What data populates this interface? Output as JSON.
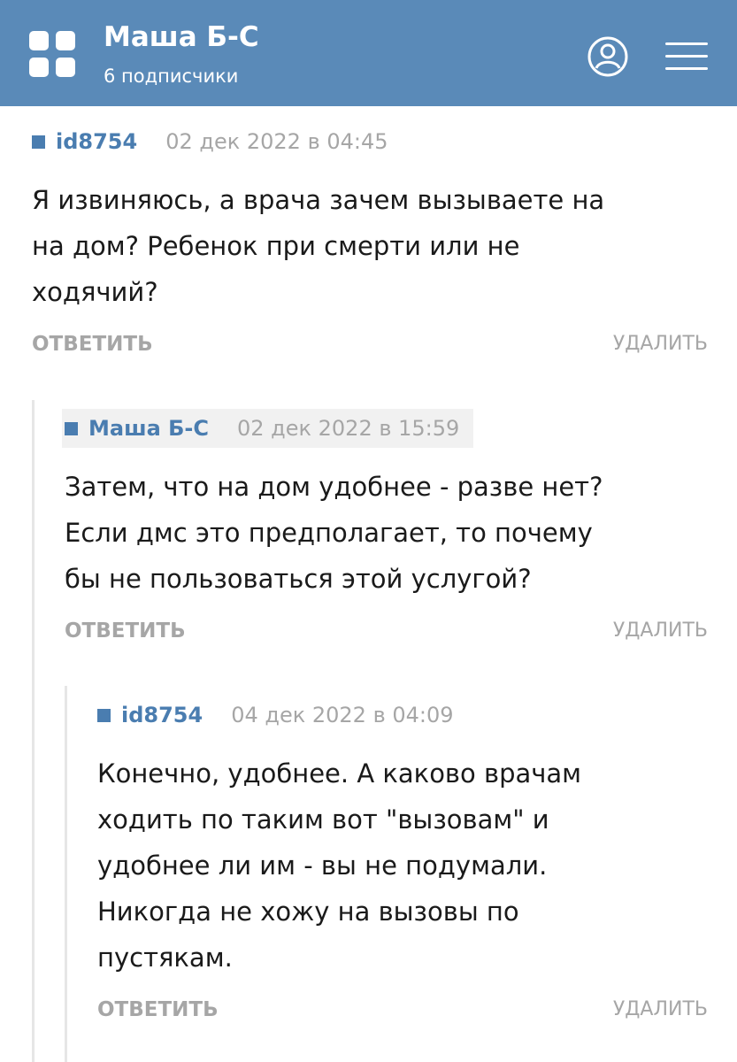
{
  "header": {
    "channel_name": "Маша Б-С",
    "subscribers": "6 подписчики",
    "background_color": "#5a8ab8",
    "logo_icon": "grid-logo-icon",
    "profile_icon": "user-profile-icon",
    "menu_icon": "hamburger-menu-icon"
  },
  "comments": [
    {
      "author": "id8754",
      "date": "02 дек 2022 в 04:45",
      "text_lines": [
        "Я извиняюсь, а врача зачем вызываете на",
        "на дом? Ребенок при смерти или не",
        "ходячий?"
      ],
      "reply_label": "ОТВЕТИТЬ",
      "delete_label": "УДАЛИТЬ"
    },
    {
      "author": "Маша Б-С",
      "date": "02 дек 2022 в 15:59",
      "text_lines": [
        "Затем, что на дом удобнее - разве нет?",
        "Если дмс это предполагает, то почему",
        "бы не пользоваться этой услугой?"
      ],
      "reply_label": "ОТВЕТИТЬ",
      "delete_label": "УДАЛИТЬ"
    },
    {
      "author": "id8754",
      "date": "04 дек 2022 в 04:09",
      "text_lines": [
        "Конечно, удобнее. А каково врачам",
        "ходить по таким вот \"вызовам\" и",
        "удобнее ли им - вы не подумали.",
        "Никогда не хожу на вызовы по",
        "пустякам."
      ],
      "reply_label": "ОТВЕТИТЬ",
      "delete_label": "УДАЛИТЬ"
    }
  ],
  "colors": {
    "author_link": "#4a7db0",
    "muted_text": "#a6a6a6",
    "thread_line": "#e6e6e6",
    "highlight_bg": "#f1f1f1"
  }
}
